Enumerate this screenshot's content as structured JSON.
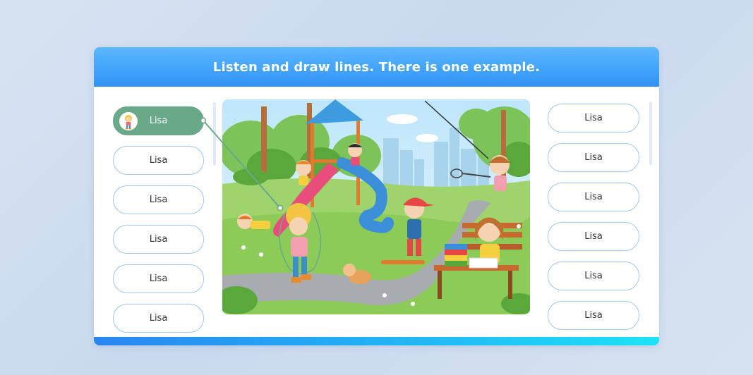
{
  "instruction": {
    "title": "Listen and draw lines. There is one example."
  },
  "left_names": [
    {
      "label": "Lisa",
      "state": "matched-example"
    },
    {
      "label": "Lisa"
    },
    {
      "label": "Lisa"
    },
    {
      "label": "Lisa"
    },
    {
      "label": "Lisa"
    },
    {
      "label": "Lisa"
    }
  ],
  "right_names": [
    {
      "label": "Lisa"
    },
    {
      "label": "Lisa"
    },
    {
      "label": "Lisa"
    },
    {
      "label": "Lisa"
    },
    {
      "label": "Lisa"
    },
    {
      "label": "Lisa"
    }
  ],
  "scene": {
    "icon": "playground-illustration",
    "characters": [
      "girl-on-slide",
      "boy-waving",
      "boy-lying",
      "girl-roller-skates",
      "dog",
      "boy-skateboard",
      "girl-badminton",
      "girl-reading-on-bench"
    ]
  },
  "colors": {
    "header_top": "#5cb8ff",
    "header_bottom": "#2e93f5",
    "active_name": "#6aa88a",
    "button_border": "#9ec8ef",
    "example_line": "#6aa88a"
  }
}
